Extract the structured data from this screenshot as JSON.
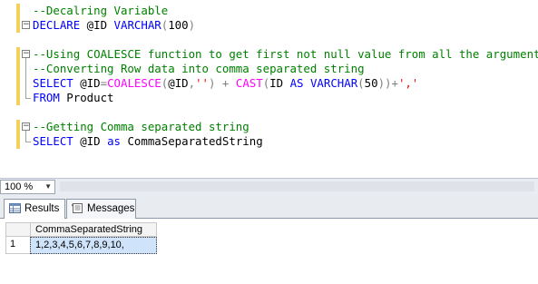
{
  "editor": {
    "lines": [
      [
        {
          "t": "--Decalring Variable",
          "c": "comment"
        }
      ],
      [
        {
          "t": "DECLARE",
          "c": "keyword"
        },
        {
          "t": " @ID ",
          "c": "id"
        },
        {
          "t": "VARCHAR",
          "c": "keyword"
        },
        {
          "t": "(",
          "c": "op"
        },
        {
          "t": "100",
          "c": "id"
        },
        {
          "t": ")",
          "c": "op"
        }
      ],
      [
        {
          "t": "",
          "c": "id"
        }
      ],
      [
        {
          "t": "--Using COALESCE function to get first not null value from all the argument",
          "c": "comment"
        }
      ],
      [
        {
          "t": "--Converting Row data into comma separated string",
          "c": "comment"
        }
      ],
      [
        {
          "t": "SELECT",
          "c": "keyword"
        },
        {
          "t": " @ID",
          "c": "id"
        },
        {
          "t": "=",
          "c": "op"
        },
        {
          "t": "COALESCE",
          "c": "fn"
        },
        {
          "t": "(",
          "c": "op"
        },
        {
          "t": "@ID",
          "c": "id"
        },
        {
          "t": ",",
          "c": "op"
        },
        {
          "t": "''",
          "c": "str"
        },
        {
          "t": ") + ",
          "c": "op"
        },
        {
          "t": "CAST",
          "c": "fn"
        },
        {
          "t": "(",
          "c": "op"
        },
        {
          "t": "ID ",
          "c": "id"
        },
        {
          "t": "AS",
          "c": "keyword"
        },
        {
          "t": " ",
          "c": "id"
        },
        {
          "t": "VARCHAR",
          "c": "keyword"
        },
        {
          "t": "(",
          "c": "op"
        },
        {
          "t": "50",
          "c": "id"
        },
        {
          "t": "))+",
          "c": "op"
        },
        {
          "t": "','",
          "c": "str"
        }
      ],
      [
        {
          "t": "FROM",
          "c": "keyword"
        },
        {
          "t": " Product",
          "c": "id"
        }
      ],
      [
        {
          "t": "",
          "c": "id"
        }
      ],
      [
        {
          "t": "--Getting Comma separated string",
          "c": "comment"
        }
      ],
      [
        {
          "t": "SELECT",
          "c": "keyword"
        },
        {
          "t": " @ID ",
          "c": "id"
        },
        {
          "t": "as",
          "c": "keyword"
        },
        {
          "t": " CommaSeparatedString",
          "c": "id"
        }
      ]
    ]
  },
  "zoom": {
    "value": "100 %"
  },
  "tabs": [
    {
      "label": "Results",
      "icon": "grid-icon"
    },
    {
      "label": "Messages",
      "icon": "messages-icon"
    }
  ],
  "grid": {
    "columns": [
      "CommaSeparatedString"
    ],
    "rows": [
      {
        "num": "1",
        "cells": [
          "1,2,3,4,5,6,7,8,9,10,"
        ]
      }
    ]
  }
}
